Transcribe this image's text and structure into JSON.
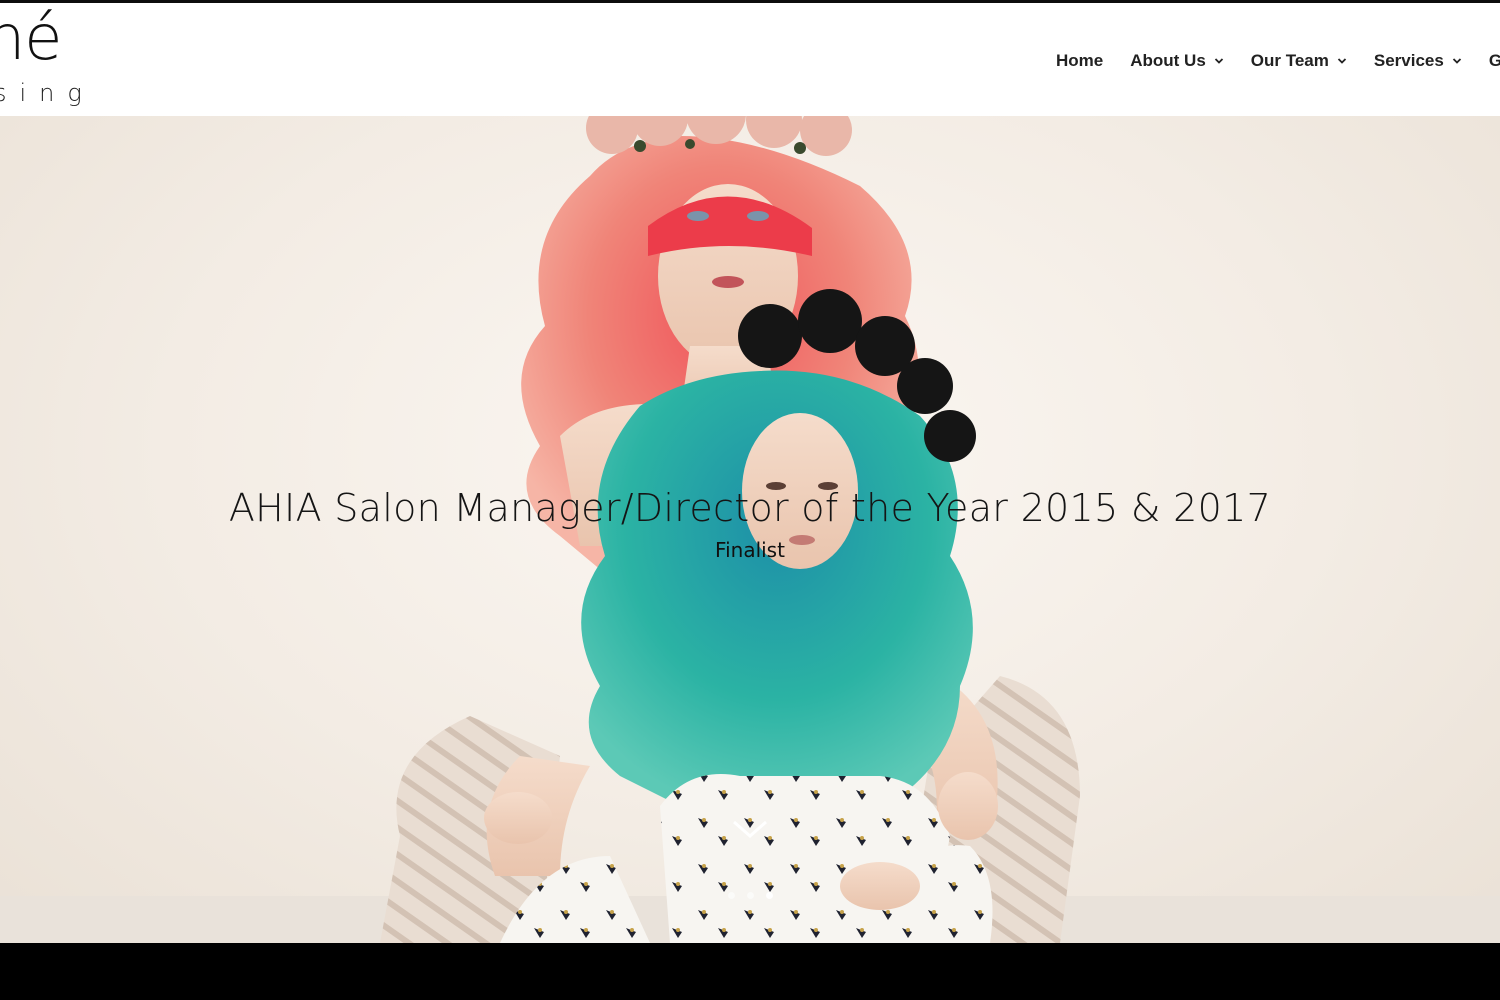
{
  "logo": {
    "big_text": "né",
    "small_text": "sing"
  },
  "nav": {
    "items": [
      {
        "label": "Home",
        "has_dropdown": false
      },
      {
        "label": "About Us",
        "has_dropdown": true
      },
      {
        "label": "Our Team",
        "has_dropdown": true
      },
      {
        "label": "Services",
        "has_dropdown": true
      },
      {
        "label": "Ga",
        "has_dropdown": false
      }
    ]
  },
  "hero": {
    "title": "AHIA Salon Manager/Director of the Year 2015 & 2017",
    "subtitle": "Finalist",
    "scroll_icon": "chevron-down-icon",
    "slide_count": 3,
    "active_slide": 2
  },
  "colors": {
    "nav_text": "#222222",
    "header_bg": "#ffffff",
    "hero_bg": "#f3ece4",
    "pink_hair": "#ee7a6e",
    "teal_hair": "#2aa7a2",
    "bottom_bar": "#000000"
  }
}
